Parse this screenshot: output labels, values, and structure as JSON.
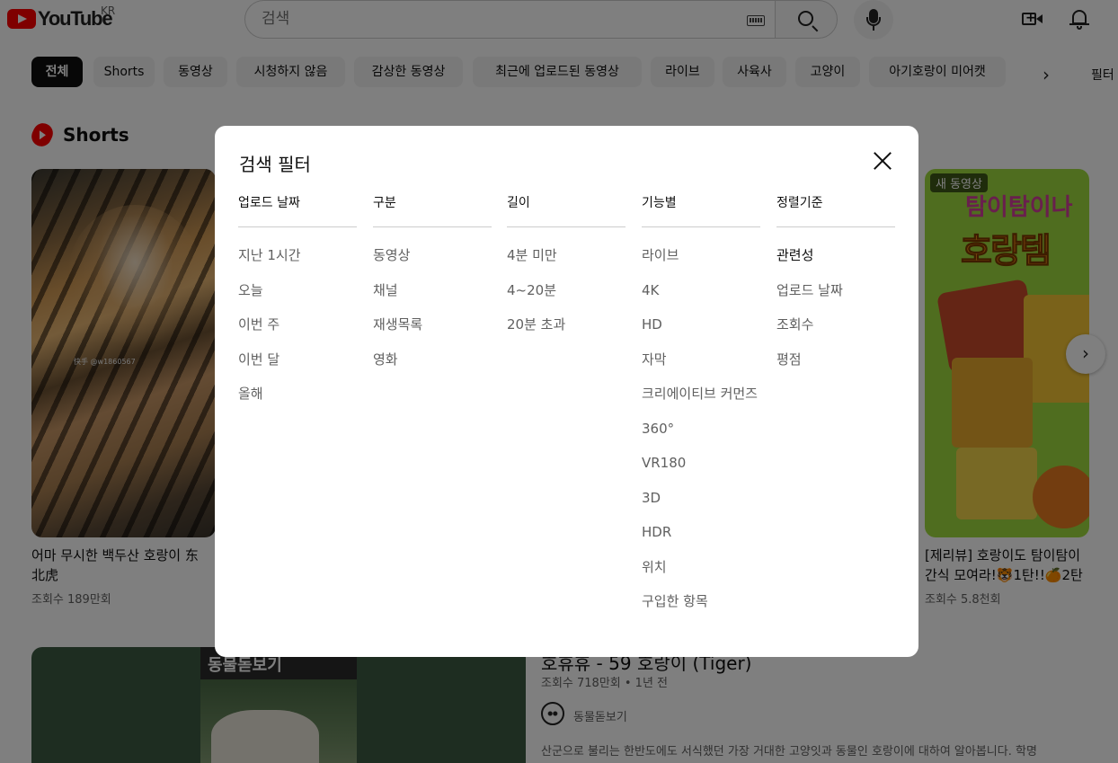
{
  "header": {
    "logo_text": "YouTube",
    "country": "KR",
    "search_placeholder": "검색"
  },
  "chips": {
    "items": [
      "전체",
      "Shorts",
      "동영상",
      "시청하지 않음",
      "감상한 동영상",
      "최근에 업로드된 동영상",
      "라이브",
      "사육사",
      "고양이",
      "아기호랑이 미어캣"
    ],
    "active_index": 0,
    "filter_label": "필터"
  },
  "shorts": {
    "section_title": "Shorts",
    "items": [
      {
        "title_line1": "어마 무시한 백두산 호랑이 东",
        "title_line2": "北虎",
        "views": "조회수 189만회",
        "watermark": "快手 @w1860567"
      },
      {
        "title_line1": "[제리뷰] 호랑이도 탐이탐이",
        "title_line2": "간식 모여라!🐯1탄!!🍊2탄",
        "views": "조회수 5.8천회",
        "badge": "새 동영상",
        "thumb_text1": "탐이탐이나",
        "thumb_text2": "호랑템"
      }
    ]
  },
  "video": {
    "title": "호휴휴 - 59 호랑이 (Tiger)",
    "meta": "조회수 718만회 • 1년 전",
    "channel": "동물돋보기",
    "thumb_tag": "동물돋보기",
    "description": "산군으로 불리는 한반도에도 서식했던 가장 거대한 고양잇과 동물인 호랑이에 대하여 알아봅니다. 학명"
  },
  "dialog": {
    "title": "검색 필터",
    "columns": [
      {
        "header": "업로드 날짜",
        "options": [
          "지난 1시간",
          "오늘",
          "이번 주",
          "이번 달",
          "올해"
        ]
      },
      {
        "header": "구분",
        "options": [
          "동영상",
          "채널",
          "재생목록",
          "영화"
        ]
      },
      {
        "header": "길이",
        "options": [
          "4분 미만",
          "4~20분",
          "20분 초과"
        ]
      },
      {
        "header": "기능별",
        "options": [
          "라이브",
          "4K",
          "HD",
          "자막",
          "크리에이티브 커먼즈",
          "360°",
          "VR180",
          "3D",
          "HDR",
          "위치",
          "구입한 항목"
        ]
      },
      {
        "header": "정렬기준",
        "options": [
          "관련성",
          "업로드 날짜",
          "조회수",
          "평점"
        ],
        "selected_index": 0
      }
    ]
  }
}
